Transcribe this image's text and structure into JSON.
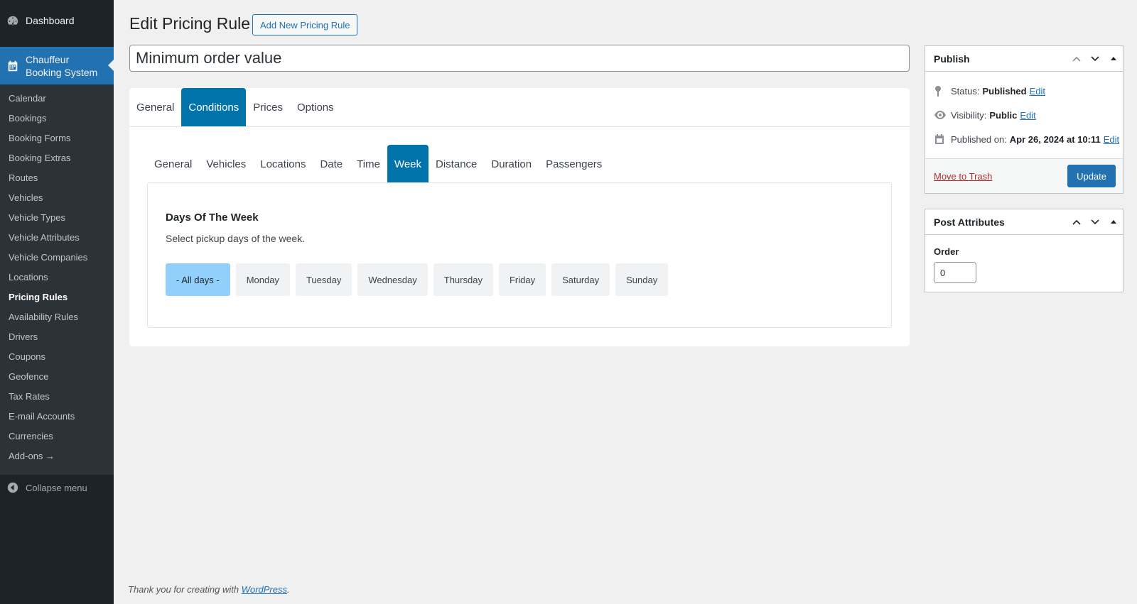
{
  "menu": {
    "dashboard": "Dashboard",
    "current_line1": "Chauffeur",
    "current_line2": "Booking System",
    "items": [
      {
        "label": "Calendar"
      },
      {
        "label": "Bookings"
      },
      {
        "label": "Booking Forms"
      },
      {
        "label": "Booking Extras"
      },
      {
        "label": "Routes"
      },
      {
        "label": "Vehicles"
      },
      {
        "label": "Vehicle Types"
      },
      {
        "label": "Vehicle Attributes"
      },
      {
        "label": "Vehicle Companies"
      },
      {
        "label": "Locations"
      },
      {
        "label": "Pricing Rules"
      },
      {
        "label": "Availability Rules"
      },
      {
        "label": "Drivers"
      },
      {
        "label": "Coupons"
      },
      {
        "label": "Geofence"
      },
      {
        "label": "Tax Rates"
      },
      {
        "label": "E-mail Accounts"
      },
      {
        "label": "Currencies"
      },
      {
        "label": "Add-ons →"
      }
    ],
    "collapse": "Collapse menu"
  },
  "page": {
    "title": "Edit Pricing Rule",
    "add_new": "Add New Pricing Rule",
    "post_title": "Minimum order value"
  },
  "tabs_main": [
    {
      "label": "General"
    },
    {
      "label": "Conditions"
    },
    {
      "label": "Prices"
    },
    {
      "label": "Options"
    }
  ],
  "tabs_sub": [
    {
      "label": "General"
    },
    {
      "label": "Vehicles"
    },
    {
      "label": "Locations"
    },
    {
      "label": "Date"
    },
    {
      "label": "Time"
    },
    {
      "label": "Week"
    },
    {
      "label": "Distance"
    },
    {
      "label": "Duration"
    },
    {
      "label": "Passengers"
    }
  ],
  "week": {
    "title": "Days Of The Week",
    "description": "Select pickup days of the week.",
    "days": [
      {
        "label": "- All days -"
      },
      {
        "label": "Monday"
      },
      {
        "label": "Tuesday"
      },
      {
        "label": "Wednesday"
      },
      {
        "label": "Thursday"
      },
      {
        "label": "Friday"
      },
      {
        "label": "Saturday"
      },
      {
        "label": "Sunday"
      }
    ]
  },
  "publish": {
    "title": "Publish",
    "status_label": "Status:",
    "status_value": "Published",
    "visibility_label": "Visibility:",
    "visibility_value": "Public",
    "published_label": "Published on:",
    "published_value": "Apr 26, 2024 at 10:11",
    "edit": "Edit",
    "trash": "Move to Trash",
    "update": "Update"
  },
  "attributes": {
    "title": "Post Attributes",
    "order_label": "Order",
    "order_value": "0"
  },
  "footer": {
    "text": "Thank you for creating with ",
    "link": "WordPress",
    "suffix": "."
  },
  "colors": {
    "sidebar": "#1d2327",
    "accent": "#2271b1",
    "tab_active": "#0073aa",
    "day_selected": "#93cffb"
  }
}
